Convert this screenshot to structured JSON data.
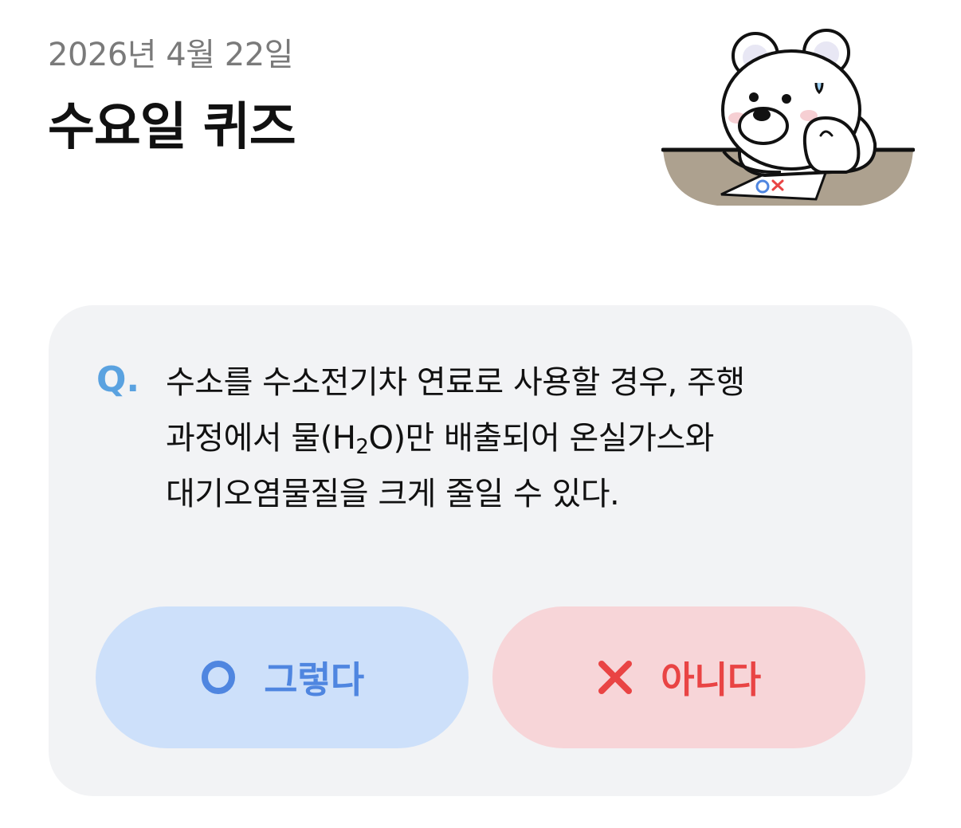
{
  "header": {
    "date": "2026년 4월 22일",
    "title": "수요일 퀴즈"
  },
  "illustration": {
    "icon": "polar-bear-mascot",
    "paper_marks": [
      "O",
      "X"
    ]
  },
  "quiz": {
    "q_label": "Q.",
    "question_lines": {
      "line1": "수소를 수소전기차 연료로 사용할 경우, 주행",
      "line2_before": "과정에서 물(H",
      "line2_sub": "2",
      "line2_after": "O)만 배출되어 온실가스와",
      "line3": "대기오염물질을 크게 줄일 수 있다."
    },
    "answers": {
      "yes": {
        "label": "그렇다",
        "icon": "circle-o-icon",
        "color": "#4f86e0",
        "bg": "#cde0fa"
      },
      "no": {
        "label": "아니다",
        "icon": "x-mark-icon",
        "color": "#e94444",
        "bg": "#f7d5d8"
      }
    }
  }
}
